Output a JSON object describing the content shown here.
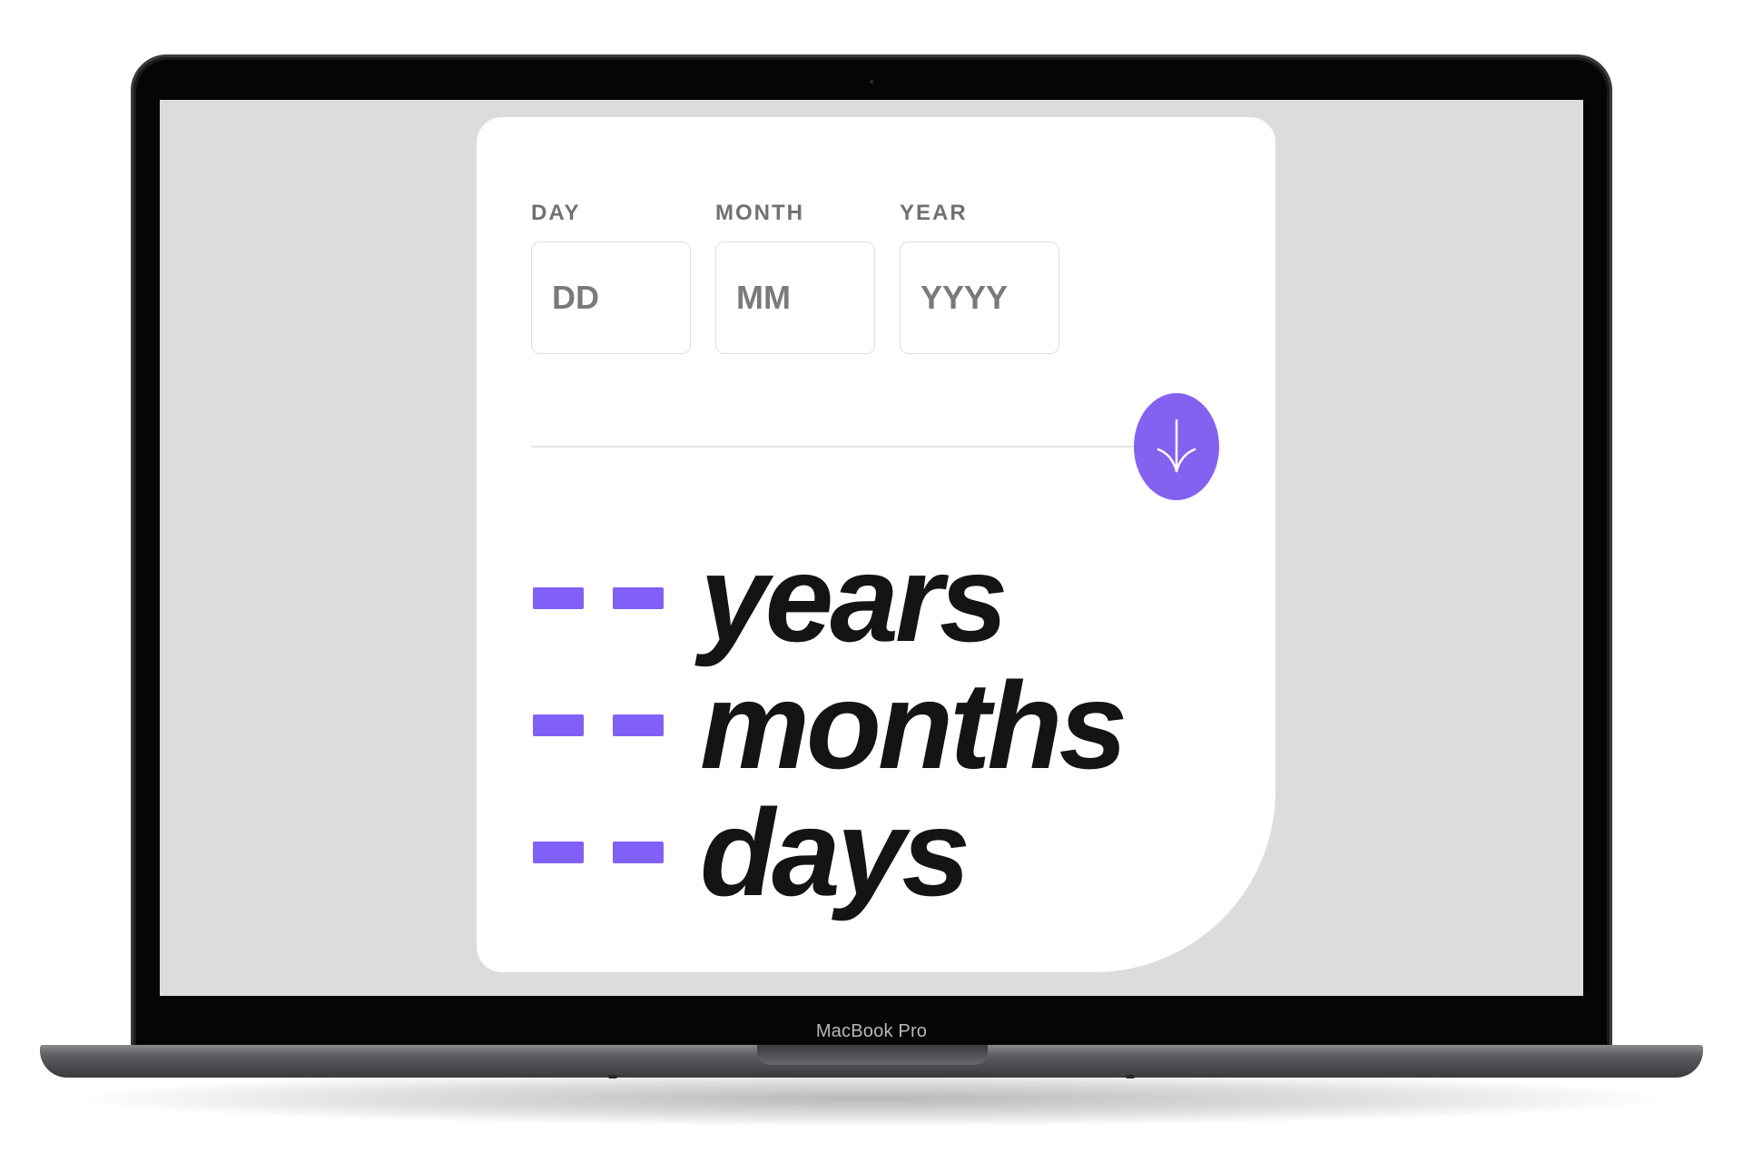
{
  "device": {
    "label": "MacBook Pro"
  },
  "form": {
    "fields": [
      {
        "label": "DAY",
        "placeholder": "DD"
      },
      {
        "label": "MONTH",
        "placeholder": "MM"
      },
      {
        "label": "YEAR",
        "placeholder": "YYYY"
      }
    ],
    "submit_icon": "arrow-down-icon"
  },
  "results": [
    {
      "value": "--",
      "unit": "years"
    },
    {
      "value": "--",
      "unit": "months"
    },
    {
      "value": "--",
      "unit": "days"
    }
  ],
  "colors": {
    "accent": "#8561f0",
    "background": "#dcdcdc",
    "card": "#ffffff",
    "text": "#141414",
    "label": "#717171"
  }
}
